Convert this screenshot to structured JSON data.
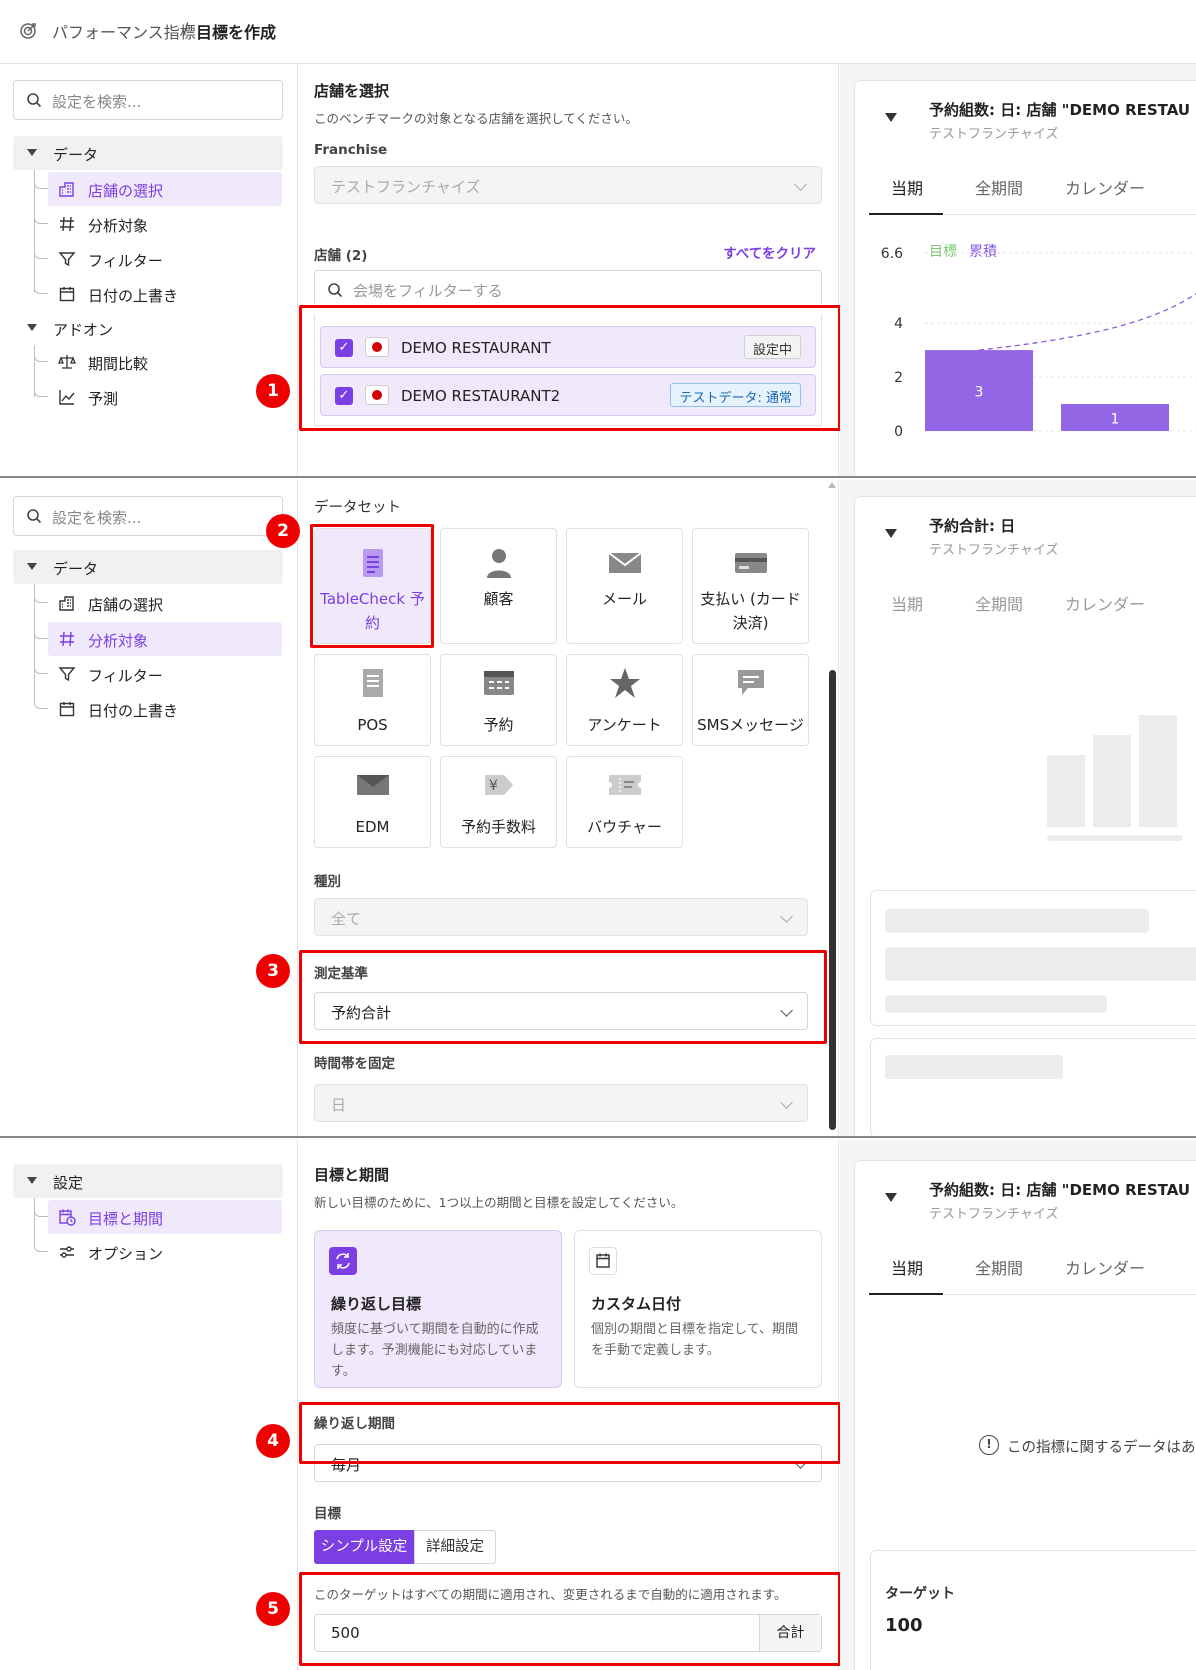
{
  "breadcrumb": {
    "parent": "パフォーマンス指標",
    "separator": "/",
    "current": "目標を作成"
  },
  "search_placeholder": "設定を検索...",
  "sidebar1": {
    "group1": "データ",
    "items1": [
      "店舗の選択",
      "分析対象",
      "フィルター",
      "日付の上書き"
    ],
    "group2": "アドオン",
    "items2": [
      "期間比較",
      "予測"
    ]
  },
  "store_section": {
    "title": "店舗を選択",
    "desc": "このベンチマークの対象となる店舗を選択してください。",
    "franchise_label": "Franchise",
    "franchise_value": "テストフランチャイズ",
    "stores_label": "店舗 (2)",
    "clear_all": "すべてをクリア",
    "filter_placeholder": "会場をフィルターする",
    "stores": [
      {
        "name": "DEMO RESTAURANT",
        "tag": "設定中"
      },
      {
        "name": "DEMO RESTAURANT2",
        "tag": "テストデータ: 通常"
      }
    ]
  },
  "preview1": {
    "title": "予約組数: 日: 店舗 \"DEMO RESTAU",
    "subtitle": "テストフランチャイズ",
    "tabs": [
      "当期",
      "全期間",
      "カレンダー"
    ],
    "legend": [
      "目標",
      "累積"
    ]
  },
  "chart_data": {
    "type": "bar",
    "categories": [
      "",
      ""
    ],
    "values": [
      3,
      1
    ],
    "yticks": [
      "6.6",
      "4",
      "2",
      "0"
    ],
    "ylim": [
      0,
      6.6
    ],
    "target_line": "dashed",
    "colors": {
      "bar": "#9366e6",
      "goal": "#7ac86f",
      "cumulative": "#8a5be0"
    }
  },
  "badges": [
    "1",
    "2",
    "3",
    "4",
    "5"
  ],
  "sidebar2": {
    "group1": "データ",
    "items": [
      "店舗の選択",
      "分析対象",
      "フィルター",
      "日付の上書き"
    ]
  },
  "dataset_section": {
    "label": "データセット",
    "tiles": [
      "TableCheck 予約",
      "顧客",
      "メール",
      "支払い (カード決済)",
      "POS",
      "予約",
      "アンケート",
      "SMSメッセージ",
      "EDM",
      "予約手数料",
      "バウチャー"
    ],
    "type_label": "種別",
    "type_value": "全て",
    "measure_label": "測定基準",
    "measure_value": "予約合計",
    "timeframe_label": "時間帯を固定",
    "timeframe_value": "日"
  },
  "preview2": {
    "title": "予約合計: 日",
    "subtitle": "テストフランチャイズ",
    "tabs": [
      "当期",
      "全期間",
      "カレンダー"
    ]
  },
  "sidebar3": {
    "group": "設定",
    "items": [
      "目標と期間",
      "オプション"
    ]
  },
  "goal_section": {
    "title": "目標と期間",
    "desc": "新しい目標のために、1つ以上の期間と目標を設定してください。",
    "options": [
      {
        "title": "繰り返し目標",
        "desc": "頻度に基づいて期間を自動的に作成します。予測機能にも対応しています。"
      },
      {
        "title": "カスタム日付",
        "desc": "個別の期間と目標を指定して、期間を手動で定義します。"
      }
    ],
    "period_label": "繰り返し期間",
    "period_value": "毎月",
    "target_label": "目標",
    "mode_tabs": [
      "シンプル設定",
      "詳細設定"
    ],
    "note": "このターゲットはすべての期間に適用され、変更されるまで自動的に適用されます。",
    "target_value": "500",
    "target_unit": "合計"
  },
  "preview3": {
    "title": "予約組数: 日: 店舗 \"DEMO RESTAU",
    "subtitle": "テストフランチャイズ",
    "tabs": [
      "当期",
      "全期間",
      "カレンダー"
    ],
    "empty_text": "この指標に関するデータはあり",
    "target_label": "ターゲット",
    "target_value": "100"
  }
}
